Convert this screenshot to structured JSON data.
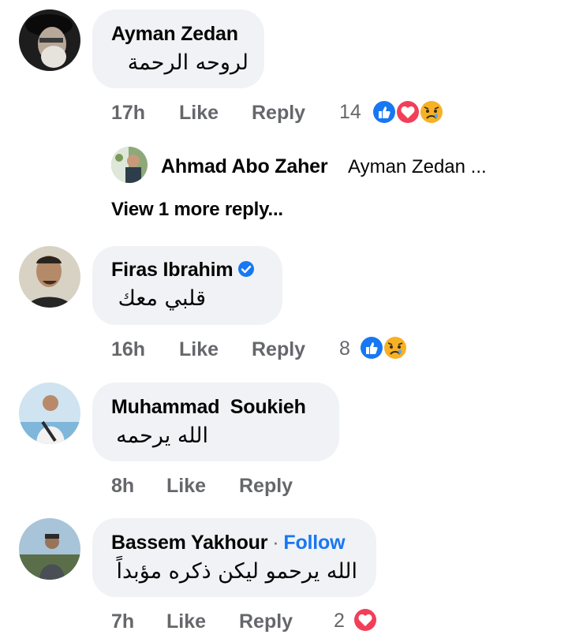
{
  "comments": [
    {
      "author": "Ayman Zedan",
      "text": "لروحه الرحمة",
      "time": "17h",
      "like": "Like",
      "reply": "Reply",
      "reaction_count": "14",
      "reactions": [
        "like-icon",
        "love-icon",
        "sad-icon"
      ]
    },
    {
      "author": "Firas Ibrahim",
      "verified": true,
      "text": "قلبي معك",
      "time": "16h",
      "like": "Like",
      "reply": "Reply",
      "reaction_count": "8",
      "reactions": [
        "like-icon",
        "sad-icon"
      ]
    },
    {
      "author": "Muhammad  Soukieh",
      "text": "الله يرحمه",
      "time": "8h",
      "like": "Like",
      "reply": "Reply"
    },
    {
      "author": "Bassem Yakhour",
      "follow": "Follow",
      "separator": "·",
      "text": "الله يرحمو ليكن ذكره مؤبداً",
      "time": "7h",
      "like": "Like",
      "reply": "Reply",
      "reaction_count": "2",
      "reactions": [
        "love-icon"
      ]
    }
  ],
  "reply_preview": {
    "author": "Ahmad Abo Zaher",
    "text": "Ayman Zedan ...",
    "view_more": "View 1 more reply..."
  },
  "colors": {
    "bubble": "#f0f2f5",
    "meta": "#65676b",
    "follow": "#1877f2",
    "like_blue": "#1877f2",
    "love_red": "#f33e58",
    "sad_yellow": "#f7b125"
  }
}
